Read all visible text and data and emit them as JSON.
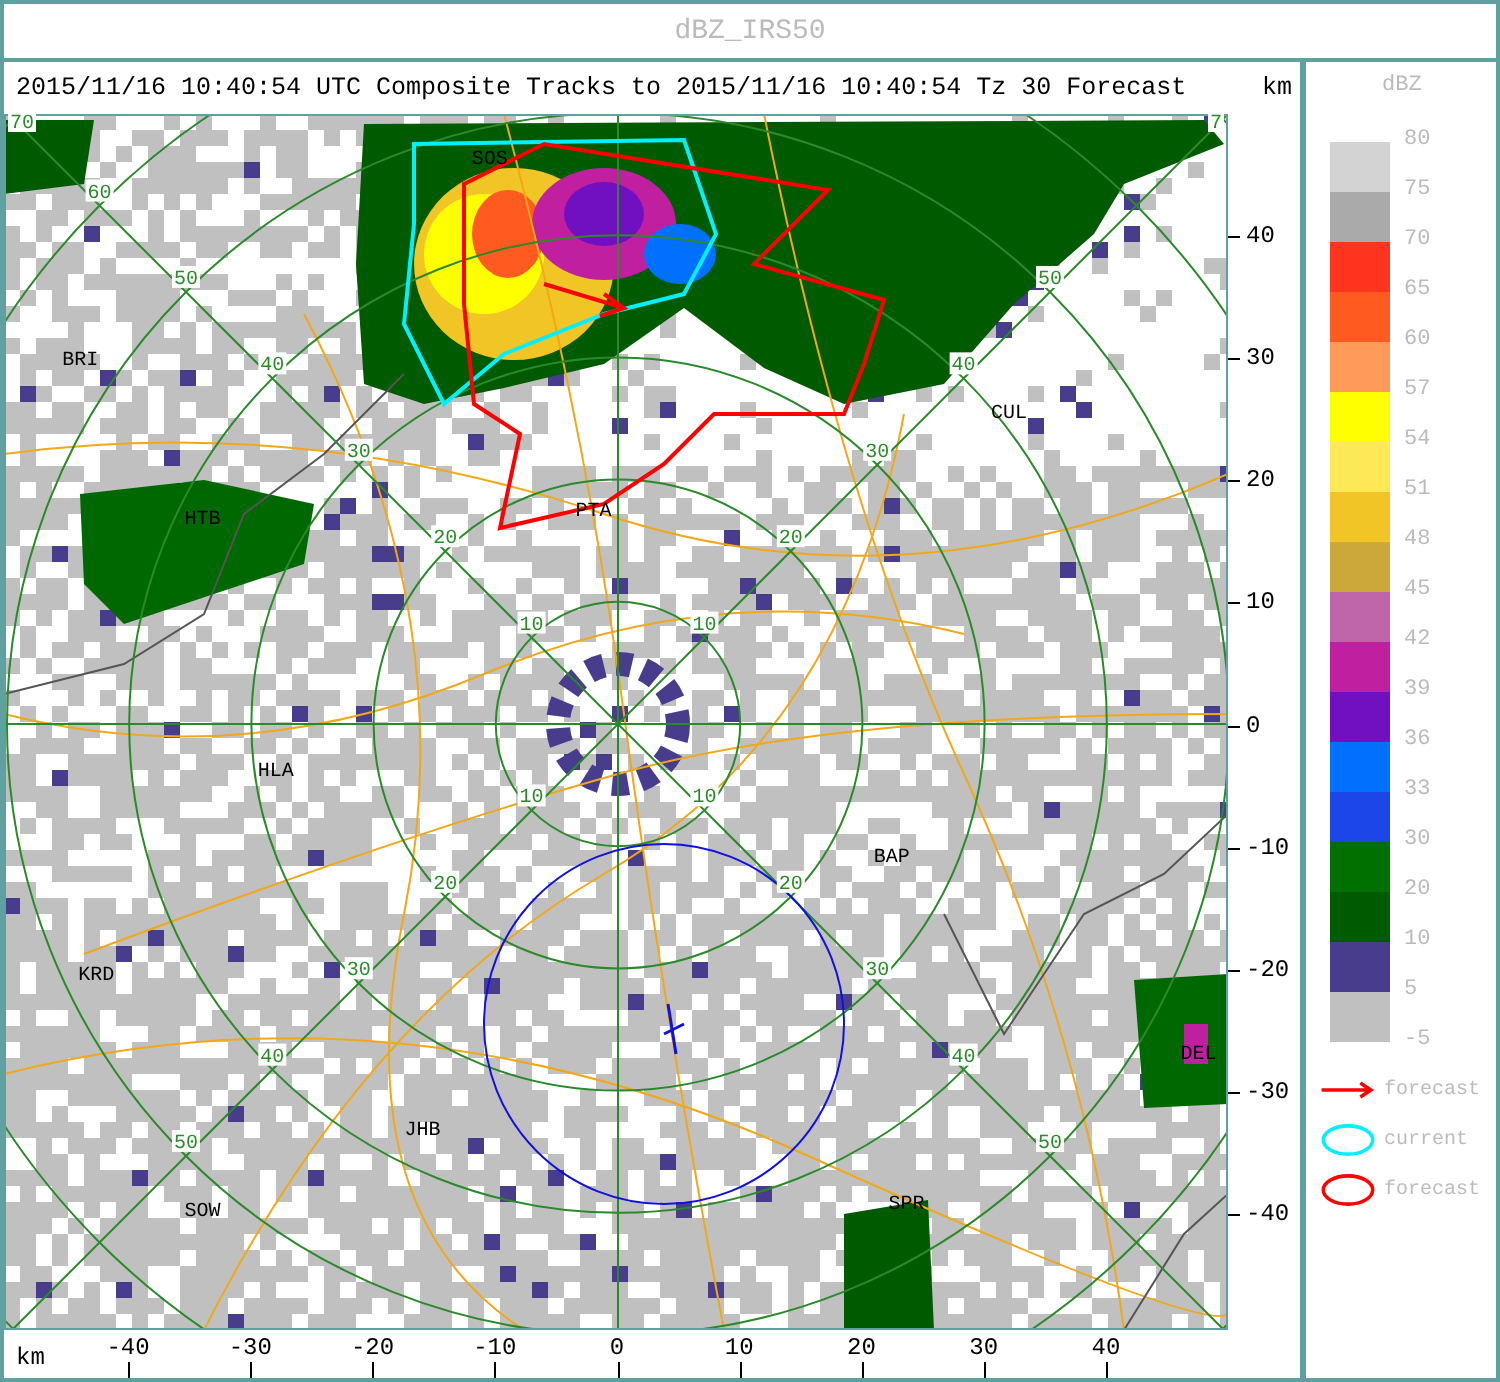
{
  "window": {
    "title": "dBZ_IRS50"
  },
  "header": {
    "text": "2015/11/16 10:40:54 UTC Composite Tracks to 2015/11/16 10:40:54 Tz 30 Forecast",
    "unit": "km"
  },
  "map": {
    "stations": [
      {
        "name": "SOS"
      },
      {
        "name": "BRI"
      },
      {
        "name": "HTB"
      },
      {
        "name": "PTA"
      },
      {
        "name": "CUL"
      },
      {
        "name": "HLA"
      },
      {
        "name": "BAP"
      },
      {
        "name": "KRD"
      },
      {
        "name": "JHB"
      },
      {
        "name": "SOW"
      },
      {
        "name": "SPR"
      },
      {
        "name": "DEL"
      }
    ],
    "range_rings": [
      {
        "labels": [
          "10",
          "10",
          "10",
          "10"
        ]
      },
      {
        "labels": [
          "20",
          "20",
          "20",
          "20"
        ]
      },
      {
        "labels": [
          "30",
          "30",
          "30",
          "30"
        ]
      },
      {
        "labels": [
          "40",
          "40",
          "40",
          "40"
        ]
      },
      {
        "labels": [
          "50",
          "50",
          "50",
          "50"
        ]
      },
      {
        "labels": [
          "60"
        ]
      },
      {
        "labels": [
          "70",
          "7"
        ]
      }
    ]
  },
  "axes": {
    "y_ticks": [
      "40",
      "30",
      "20",
      "10",
      "0",
      "-10",
      "-20",
      "-30",
      "-40"
    ],
    "x_unit": "km",
    "x_ticks": [
      "-40",
      "-30",
      "-20",
      "-10",
      "0",
      "10",
      "20",
      "30",
      "40"
    ]
  },
  "legend": {
    "title": "dBZ",
    "bins": [
      {
        "label": "80",
        "color": "#d3d3d3"
      },
      {
        "label": "75",
        "color": "#aaaaaa"
      },
      {
        "label": "70",
        "color": "#ff3520"
      },
      {
        "label": "65",
        "color": "#ff5a20"
      },
      {
        "label": "60",
        "color": "#ff9a5a"
      },
      {
        "label": "57",
        "color": "#ffff00"
      },
      {
        "label": "54",
        "color": "#fde855"
      },
      {
        "label": "51",
        "color": "#f2c526"
      },
      {
        "label": "48",
        "color": "#cca83a"
      },
      {
        "label": "45",
        "color": "#bf66aa"
      },
      {
        "label": "42",
        "color": "#c020a0"
      },
      {
        "label": "39",
        "color": "#7010c0"
      },
      {
        "label": "36",
        "color": "#0070ff"
      },
      {
        "label": "33",
        "color": "#1c46e8"
      },
      {
        "label": "30",
        "color": "#007000"
      },
      {
        "label": "20",
        "color": "#005a00"
      },
      {
        "label": "10",
        "color": "#483c8c"
      },
      {
        "label": "5",
        "color": "#c0c0c0"
      }
    ],
    "lowest": "-5",
    "keys": [
      {
        "kind": "arrow",
        "label": "forecast"
      },
      {
        "kind": "current",
        "label": "current"
      },
      {
        "kind": "forecast",
        "label": "forecast"
      }
    ]
  }
}
